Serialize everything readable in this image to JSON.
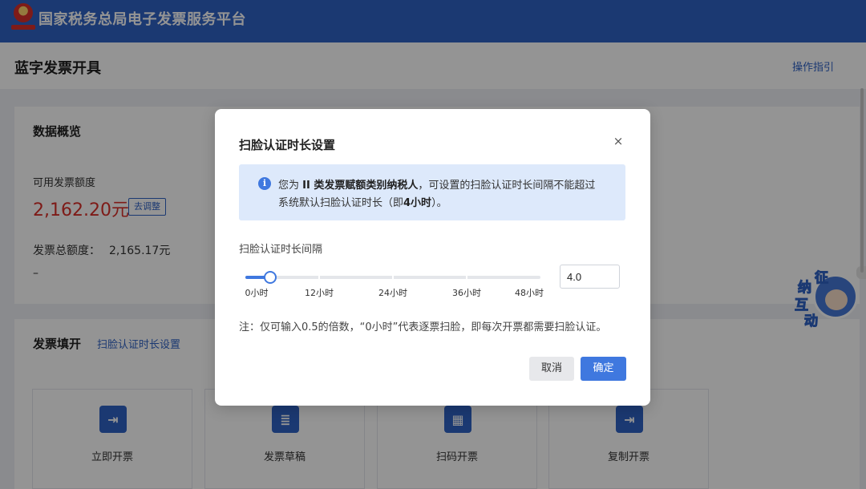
{
  "header": {
    "site_title": "国家税务总局电子发票服务平台"
  },
  "subbar": {
    "page_title": "蓝字发票开具",
    "guide_link": "操作指引"
  },
  "overview": {
    "heading": "数据概览",
    "available_label": "可用发票额度",
    "available_amount": "2,162.20元",
    "adjust_button": "去调整",
    "total_label": "发票总额度：",
    "total_value": "2,165.17元",
    "dash": "–"
  },
  "fill": {
    "heading": "发票填开",
    "face_link": "扫脸认证时长设置",
    "tiles": [
      {
        "label": "立即开票",
        "icon": "invoice-ticket-icon",
        "glyph": "⇥"
      },
      {
        "label": "发票草稿",
        "icon": "draft-icon",
        "glyph": "≣"
      },
      {
        "label": "扫码开票",
        "icon": "qr-code-icon",
        "glyph": "▦"
      },
      {
        "label": "复制开票",
        "icon": "copy-invoice-icon",
        "glyph": "⇥"
      }
    ]
  },
  "mascot": {
    "chars": [
      "征",
      "纳",
      "互",
      "动"
    ]
  },
  "modal": {
    "title": "扫脸认证时长设置",
    "close": "×",
    "notice": {
      "icon_glyph": "i",
      "l1_a": "您为 ",
      "l1_b": "II 类发票赋额类别纳税人",
      "l1_c": "，可设置的扫脸认证时长间隔不能超过",
      "l2_a": "系统默认扫脸认证时长（即",
      "l2_b": "4小时",
      "l2_c": "）。"
    },
    "slider": {
      "label": "扫脸认证时长间隔",
      "min": 0,
      "max": 48,
      "value": 4.0,
      "ticks": [
        {
          "v": 0,
          "label": "0小时"
        },
        {
          "v": 12,
          "label": "12小时"
        },
        {
          "v": 24,
          "label": "24小时"
        },
        {
          "v": 36,
          "label": "36小时"
        },
        {
          "v": 48,
          "label": "48小时"
        }
      ]
    },
    "input_value": "4.0",
    "note": "注：仅可输入0.5的倍数，“0小时”代表逐票扫脸，即每次开票都需要扫脸认证。",
    "cancel": "取消",
    "ok": "确定"
  },
  "colors": {
    "brand": "#2f62c5",
    "accent": "#3f78df",
    "amount": "#d9302a",
    "notice_bg": "#dde9fb"
  }
}
